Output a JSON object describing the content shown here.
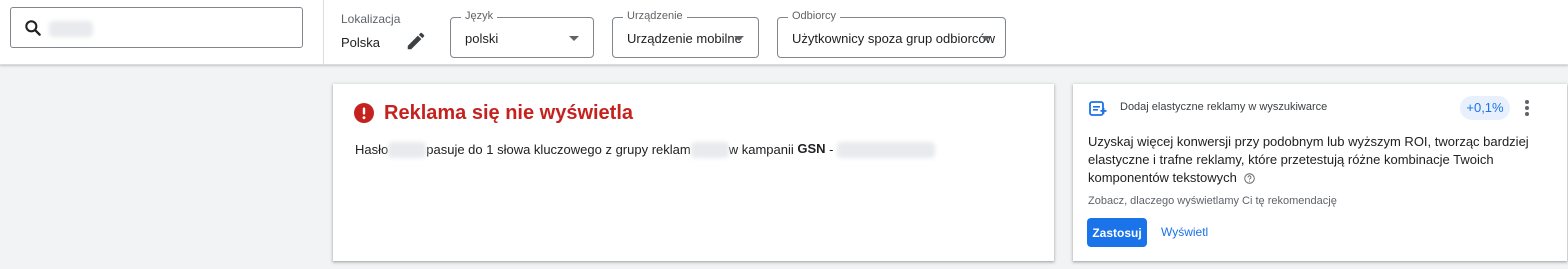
{
  "location": {
    "label": "Lokalizacja",
    "value": "Polska"
  },
  "language": {
    "label": "Język",
    "value": "polski"
  },
  "device": {
    "label": "Urządzenie",
    "value": "Urządzenie mobilne"
  },
  "audience": {
    "label": "Odbiorcy",
    "value": "Użytkownicy spoza grup odbiorców"
  },
  "icons": {
    "search": "search-icon",
    "edit": "pencil-icon",
    "error": "error-icon",
    "recommendation": "responsive-ad-icon",
    "more": "more-vert-icon",
    "help": "help-icon"
  },
  "result": {
    "title": "Reklama się nie wyświetla",
    "desc_part1": "Hasło",
    "desc_part2": "pasuje do 1 słowa kluczowego z grupy reklam",
    "desc_part3": "w kampanii",
    "desc_campaign": "GSN",
    "desc_dash": "-"
  },
  "recommendation": {
    "header": "Dodaj elastyczne reklamy w wyszukiwarce",
    "badge": "+0,1%",
    "body": "Uzyskaj więcej konwersji przy podobnym lub wyższym ROI, tworząc bardziej elastyczne i trafne reklamy, które przetestują różne kombinacje Twoich komponentów tekstowych",
    "why": "Zobacz, dlaczego wyświetlamy Ci tę rekomendację",
    "apply": "Zastosuj",
    "view": "Wyświetl"
  },
  "colors": {
    "error": "#c5221f",
    "accent": "#1a73e8",
    "badge_bg": "#e8f0fe"
  }
}
